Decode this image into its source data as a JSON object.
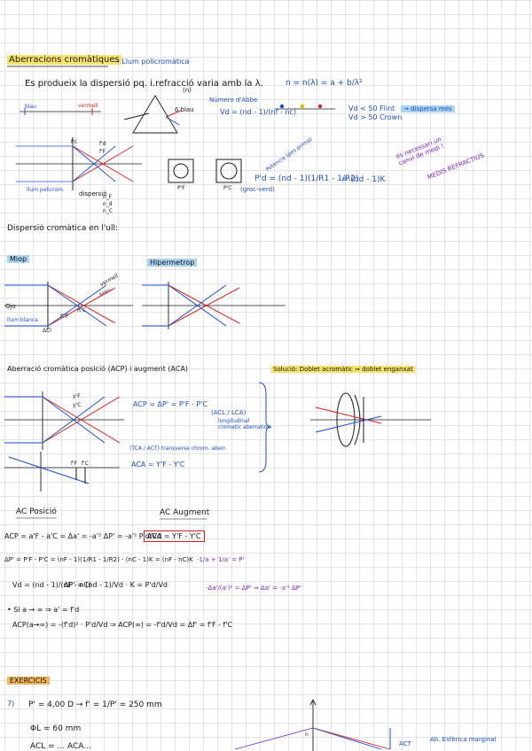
{
  "colors": {
    "ink": "#1a1a1a",
    "blue": "#1b4bd6",
    "red": "#d62020",
    "purple": "#7a1fd0",
    "highlight_yellow": "#f7e26a",
    "highlight_blue": "#a9d4f2",
    "highlight_orange": "#f3b55c"
  },
  "section1": {
    "title": "Aberracions cromàtiques",
    "arrow_note": "→ Llum policromàtica",
    "line1": "Es produeix la dispersió  pq. i.refracció varia amb la λ.",
    "formula": "n = n(λ) = a + b/λ²",
    "n_under": "(n)",
    "abbe_label": "Número d'Abbe",
    "abbe_formula": "Vd = (nd - 1)/(nf - nc)",
    "abbe_cond1": "Vd < 50 Flint",
    "abbe_cond1_note": "→ dispersa més",
    "abbe_cond2": "Vd > 50 Crown",
    "spectrum_labels": [
      "F",
      "d",
      "C",
      "d"
    ],
    "blau": "blau",
    "vermell": "vermell",
    "prism_label": "δ blau",
    "diagram_labels": [
      "f'c",
      "f'd",
      "f'F",
      "dispersió",
      "n_F",
      "n_d",
      "n_C",
      "llum policrom."
    ],
    "power_note": "Potència (pes prima)",
    "power_formula": "P'd = (nd - 1)(1/R1 - 1/R2)",
    "power_tail": "= (nd - 1)K",
    "groc": "(groc-verd)",
    "note_purple": "és necessari un canvi de medi !",
    "note_purple2": "MEDIS REFRACTIUS",
    "small_box_labels": [
      "P'F",
      "P'C"
    ]
  },
  "section2": {
    "title": "Dispersió cromàtica en l'ull:",
    "miop": "Miop",
    "hipermetrop": "Hipermetrop",
    "labels": [
      "vermell",
      "blau",
      "llum blanca",
      "ΔCl",
      "R'F",
      "R'C"
    ],
    "axis": "Ojo"
  },
  "section3": {
    "title": "Aberració cromàtica posició (ACP) i augment (ACA)",
    "solution": "Solució: Doblet acromàtic ⇒ doblet enganxat",
    "acp_eq": "ACP = ΔP' = P'F - P'C",
    "acl": "(ACL / LCA)",
    "acl_note": "longitudinal cromatic aberration",
    "tca_note": "(TCA / ACT) transverse chrom. aberr.",
    "aca_eq": "ACA = Y'F - Y'C",
    "labels": [
      "y'F",
      "y'C",
      "f'F",
      "f'C"
    ]
  },
  "section4": {
    "ac_posicio": "AC Posició",
    "ac_augment": "AC Augment",
    "acp_line": "ACP = a'F - a'C = Δa' = -a'² ΔP' = -a'² P'd/Vd",
    "aca_box": "ACA = Y'F - Y'C",
    "dp_line": "ΔP' = P'F - P'C = (nF - 1)(1/R1 - 1/R2) - (nC - 1)K = (nF - nC)K",
    "vd_line": "Vd = (nd - 1)/(nF - nC)",
    "dp_line2": "ΔP' = (nd - 1)/Vd · K = P'd/Vd",
    "side1": "-1/a + 1/a' = P'",
    "side2": "-Δa'/(a')² = ΔP'  ⇒  Δa' = -a'² ΔP'",
    "si": "• Si  a → ∞  ⇒  a' = f'd",
    "acp_inf": "ACP(a→∞) = -(f'd)² · P'd/Vd ⇒ ACP(∞) = -f'd/Vd = Δf' = f'F - f'C"
  },
  "section5": {
    "title": "EXERCICIS",
    "num": "7)",
    "p_line": "P' = 4,00 D  →  f' = 1/P' = 250 mm",
    "phi_line": "ΦL = 60 mm",
    "last_line": "ACL = ... ACA...",
    "act_label": "ACT",
    "aa_label": "Ab. Esfèrica marginal",
    "n_label": "n"
  }
}
